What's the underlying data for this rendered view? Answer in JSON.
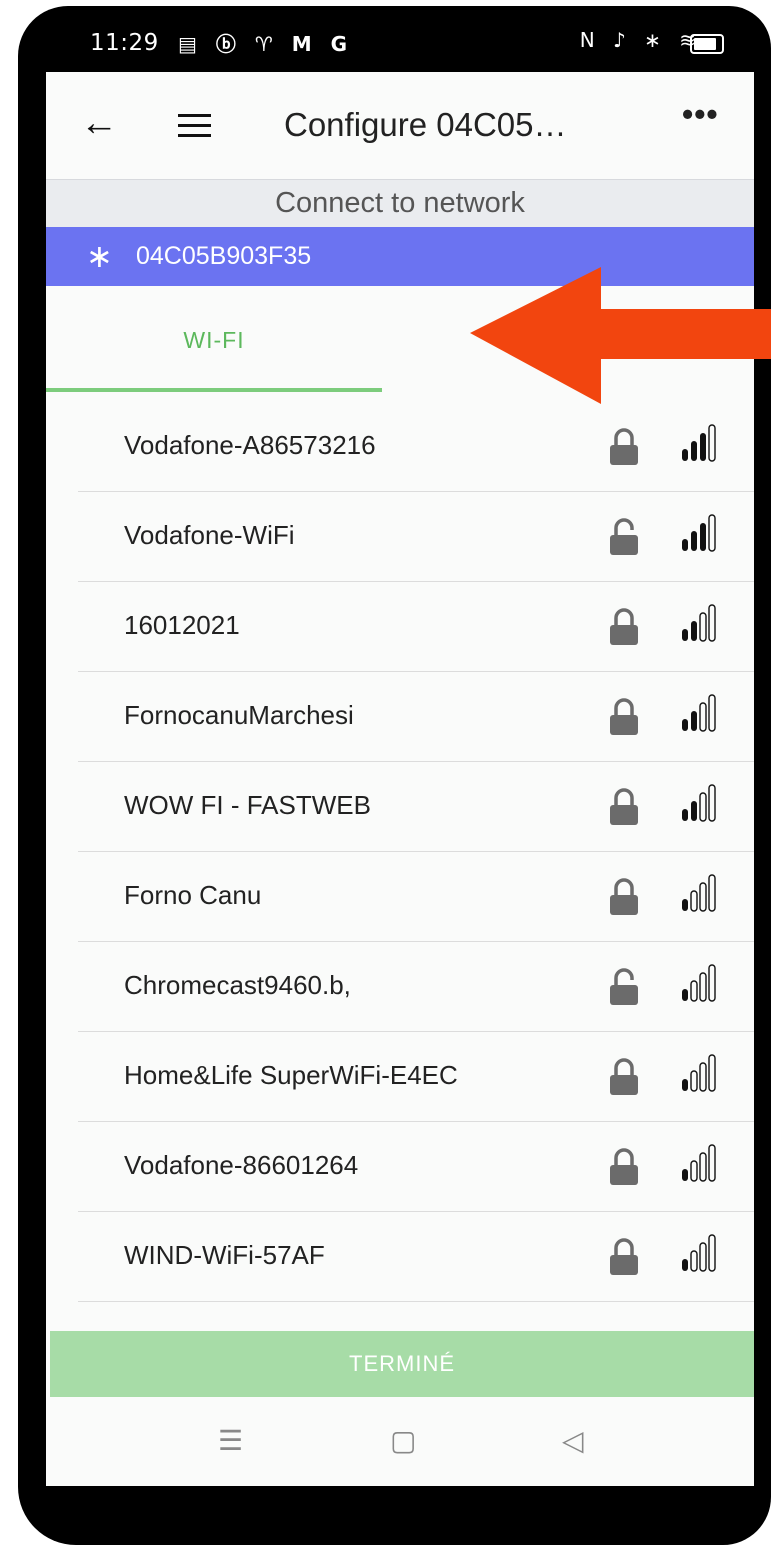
{
  "status_bar": {
    "time": "11:29",
    "notification_icons": "▤ ⓑ ♈ M G",
    "system_icons": "N ♪ ∗ ≋"
  },
  "app_bar": {
    "title": "Configure 04C05…",
    "back_icon": "arrow-left",
    "menu_icon": "hamburger",
    "more_label": "•••"
  },
  "connect_banner": "Connect to network",
  "device": {
    "id": "04C05B903F35",
    "icon": "bluetooth-icon"
  },
  "tabs": [
    {
      "label": "WI-FI",
      "active": true
    }
  ],
  "networks": [
    {
      "ssid": "Vodafone-A86573216",
      "locked": true,
      "signal": 3
    },
    {
      "ssid": "Vodafone-WiFi",
      "locked": false,
      "signal": 3
    },
    {
      "ssid": "16012021",
      "locked": true,
      "signal": 2
    },
    {
      "ssid": "FornocanuMarchesi",
      "locked": true,
      "signal": 2
    },
    {
      "ssid": "WOW FI - FASTWEB",
      "locked": true,
      "signal": 2
    },
    {
      "ssid": "Forno Canu",
      "locked": true,
      "signal": 1
    },
    {
      "ssid": "Chromecast9460.b,",
      "locked": false,
      "signal": 1
    },
    {
      "ssid": "Home&Life SuperWiFi-E4EC",
      "locked": true,
      "signal": 1
    },
    {
      "ssid": "Vodafone-86601264",
      "locked": true,
      "signal": 1
    },
    {
      "ssid": "WIND-WiFi-57AF",
      "locked": true,
      "signal": 1
    }
  ],
  "done_button": "TERMINÉ",
  "system_nav": {
    "menu": "☰",
    "home": "▢",
    "back": "◁"
  },
  "colors": {
    "accent_green": "#5cb85c",
    "device_bar": "#6b73f1",
    "done_button": "#a7dca7",
    "annotation_arrow": "#f2450f"
  }
}
